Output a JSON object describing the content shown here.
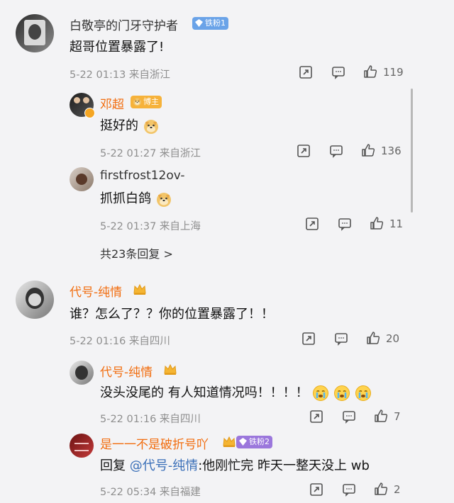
{
  "comments": [
    {
      "username": "白敬亭的门牙守护者",
      "badge": "铁粉1",
      "content": "超哥位置暴露了!",
      "time": "5-22 01:13",
      "location": "来自浙江",
      "likes": "119",
      "replies": [
        {
          "username": "邓超",
          "badge": "博主",
          "content": "挺好的",
          "time": "5-22 01:27",
          "location": "来自浙江",
          "likes": "136"
        },
        {
          "username": "firstfrost12ov-",
          "content": "抓抓白鸽",
          "time": "5-22 01:37",
          "location": "来自上海",
          "likes": "11"
        }
      ],
      "more_replies": "共23条回复 >"
    },
    {
      "username": "代号-纯情",
      "content": "谁？怎么了？？你的位置暴露了！！",
      "time": "5-22 01:16",
      "location": "来自四川",
      "likes": "20",
      "replies": [
        {
          "username": "代号-纯情",
          "content": "没头没尾的 有人知道情况吗！！！！",
          "time": "5-22 01:16",
          "location": "来自四川",
          "likes": "7"
        },
        {
          "username": "是一一不是破折号吖",
          "badge": "铁粉2",
          "content_prefix": "回复",
          "mention": "@代号-纯情",
          "content": ":他刚忙完 昨天一整天没上 wb",
          "time": "5-22 05:34",
          "location": "来自福建",
          "likes": "2"
        }
      ]
    }
  ],
  "icons": {
    "share": "share-icon",
    "comment": "comment-icon",
    "like": "thumbs-up-icon"
  },
  "colors": {
    "accent_orange": "#f26d0f",
    "meta_gray": "#8e8e8e",
    "mention_blue": "#3a6fb8"
  }
}
